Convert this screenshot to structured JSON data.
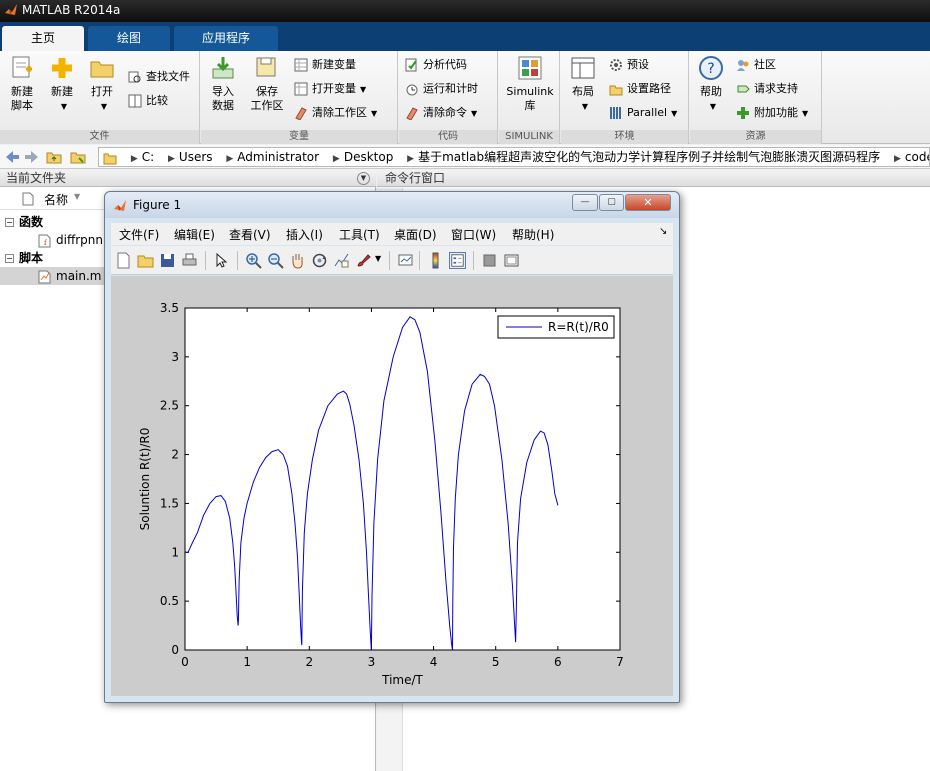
{
  "app": {
    "title": "MATLAB R2014a"
  },
  "tabs": [
    {
      "label": "主页",
      "active": true
    },
    {
      "label": "绘图",
      "active": false
    },
    {
      "label": "应用程序",
      "active": false
    }
  ],
  "ribbon": {
    "file": {
      "label": "文件",
      "new_script": "新建\n脚本",
      "new": "新建",
      "open": "打开",
      "find_files": "查找文件",
      "compare": "比较"
    },
    "variable": {
      "label": "变量",
      "import": "导入\n数据",
      "save_ws": "保存\n工作区",
      "new_var": "新建变量",
      "open_var": "打开变量",
      "clear_ws": "清除工作区"
    },
    "code": {
      "label": "代码",
      "analyze": "分析代码",
      "run_time": "运行和计时",
      "clear_cmd": "清除命令"
    },
    "simulink": {
      "label": "SIMULINK",
      "lib": "Simulink\n库"
    },
    "env": {
      "label": "环境",
      "layout": "布局",
      "prefs": "预设",
      "set_path": "设置路径",
      "parallel": "Parallel"
    },
    "resources": {
      "label": "资源",
      "help": "帮助",
      "community": "社区",
      "support": "请求支持",
      "addons": "附加功能"
    }
  },
  "address": {
    "crumbs": [
      "C:",
      "Users",
      "Administrator",
      "Desktop",
      "基于matlab编程超声波空化的气泡动力学计算程序例子并绘制气泡膨胀溃灭图源码程序",
      "code"
    ]
  },
  "left_panel": {
    "title": "当前文件夹",
    "col_name": "名称",
    "sections": [
      {
        "label": "函数",
        "files": [
          "diffrpnn"
        ]
      },
      {
        "label": "脚本",
        "files": [
          "main.m"
        ]
      }
    ]
  },
  "right_panel": {
    "title": "命令行窗口"
  },
  "figure": {
    "title": "Figure 1",
    "menus": [
      "文件(F)",
      "编辑(E)",
      "查看(V)",
      "插入(I)",
      "工具(T)",
      "桌面(D)",
      "窗口(W)",
      "帮助(H)"
    ]
  },
  "colors": {
    "accent": "#0c3f73",
    "series": "#0000cc"
  },
  "chart_data": {
    "type": "line",
    "xlabel": "Time/T",
    "ylabel": "Soluntion R(t)/R0",
    "xlim": [
      0,
      7
    ],
    "ylim": [
      0,
      3.5
    ],
    "xticks": [
      0,
      1,
      2,
      3,
      4,
      5,
      6,
      7
    ],
    "yticks": [
      0,
      0.5,
      1,
      1.5,
      2,
      2.5,
      3,
      3.5
    ],
    "legend_position": "top-right",
    "series": [
      {
        "name": "R=R(t)/R0",
        "x": [
          0,
          0.05,
          0.12,
          0.2,
          0.3,
          0.4,
          0.5,
          0.58,
          0.65,
          0.72,
          0.77,
          0.8,
          0.82,
          0.84,
          0.855,
          0.86,
          0.87,
          0.9,
          0.95,
          1.0,
          1.1,
          1.2,
          1.3,
          1.4,
          1.5,
          1.58,
          1.65,
          1.72,
          1.77,
          1.81,
          1.84,
          1.86,
          1.875,
          1.88,
          1.89,
          1.92,
          1.97,
          2.05,
          2.15,
          2.3,
          2.45,
          2.55,
          2.6,
          2.65,
          2.72,
          2.8,
          2.87,
          2.92,
          2.95,
          2.98,
          2.995,
          3.0,
          3.01,
          3.04,
          3.1,
          3.2,
          3.35,
          3.5,
          3.62,
          3.7,
          3.78,
          3.9,
          4.02,
          4.12,
          4.2,
          4.26,
          4.29,
          4.305,
          4.31,
          4.32,
          4.35,
          4.4,
          4.5,
          4.62,
          4.75,
          4.82,
          4.9,
          4.98,
          5.1,
          5.2,
          5.27,
          5.3,
          5.32,
          5.33,
          5.35,
          5.4,
          5.5,
          5.62,
          5.72,
          5.78,
          5.84,
          5.9,
          5.95,
          6.0
        ],
        "y": [
          1.0,
          1.0,
          1.1,
          1.2,
          1.38,
          1.5,
          1.57,
          1.58,
          1.52,
          1.35,
          1.1,
          0.85,
          0.6,
          0.35,
          0.25,
          0.3,
          0.7,
          1.1,
          1.35,
          1.5,
          1.72,
          1.87,
          1.97,
          2.03,
          2.05,
          2.0,
          1.88,
          1.6,
          1.3,
          0.95,
          0.55,
          0.25,
          0.08,
          0.05,
          0.6,
          1.2,
          1.6,
          1.95,
          2.25,
          2.5,
          2.62,
          2.65,
          2.62,
          2.52,
          2.3,
          1.95,
          1.5,
          1.0,
          0.6,
          0.2,
          0.04,
          0.0,
          0.55,
          1.3,
          1.95,
          2.55,
          3.0,
          3.3,
          3.41,
          3.38,
          3.25,
          2.85,
          2.15,
          1.4,
          0.7,
          0.25,
          0.06,
          0.0,
          0.5,
          1.05,
          1.55,
          2.0,
          2.45,
          2.72,
          2.82,
          2.8,
          2.72,
          2.5,
          1.95,
          1.3,
          0.65,
          0.3,
          0.08,
          0.35,
          1.1,
          1.55,
          1.92,
          2.15,
          2.24,
          2.22,
          2.1,
          1.85,
          1.6,
          1.48
        ]
      }
    ]
  }
}
